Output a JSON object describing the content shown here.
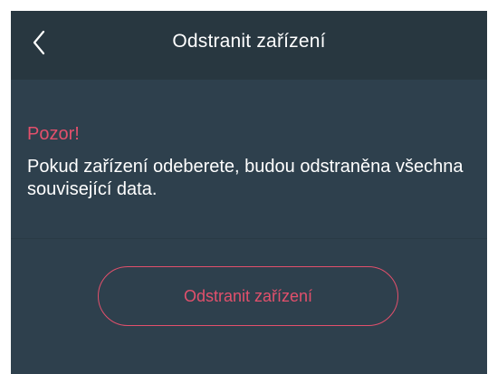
{
  "header": {
    "title": "Odstranit zařízení",
    "back_icon": "chevron-left-icon"
  },
  "warning": {
    "title": "Pozor!",
    "message": "Pokud zařízení odeberete, budou odstraněna všechna související data."
  },
  "actions": {
    "remove_label": "Odstranit zařízení"
  },
  "colors": {
    "background": "#2e404d",
    "header_background": "#283740",
    "accent": "#e2506c",
    "text": "#ffffff"
  }
}
